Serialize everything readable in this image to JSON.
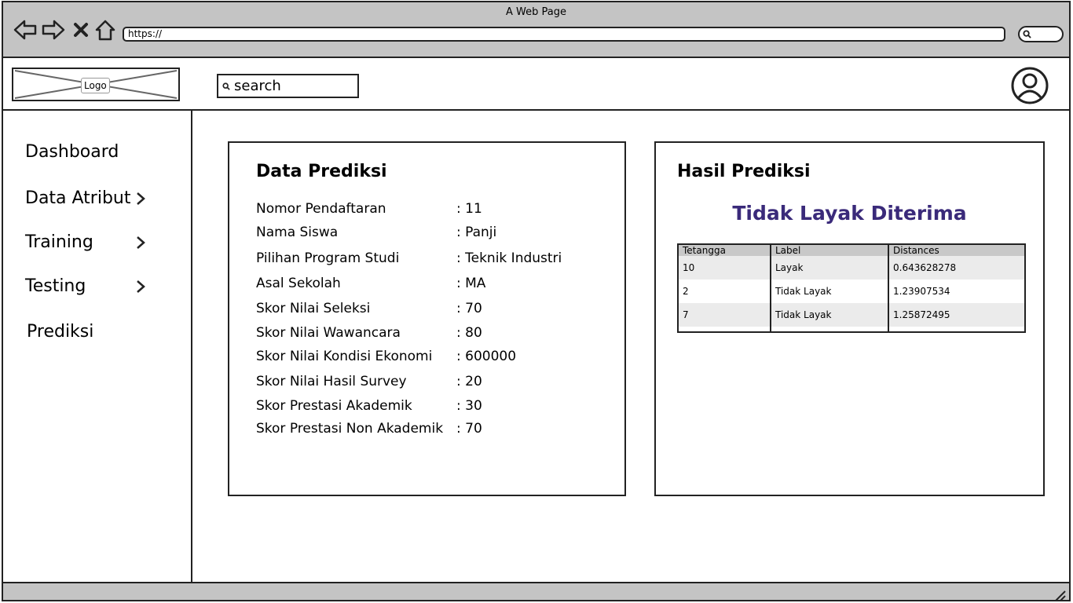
{
  "browser": {
    "window_title": "A Web Page",
    "url": "https://"
  },
  "header": {
    "logo_label": "Logo",
    "search_placeholder": "search"
  },
  "sidebar": {
    "items": [
      {
        "label": "Dashboard",
        "has_submenu": false
      },
      {
        "label": "Data Atribut",
        "has_submenu": true
      },
      {
        "label": "Training",
        "has_submenu": true
      },
      {
        "label": "Testing",
        "has_submenu": true
      },
      {
        "label": "Prediksi",
        "has_submenu": false
      }
    ]
  },
  "data_prediksi": {
    "title": "Data Prediksi",
    "fields": [
      {
        "label": "Nomor Pendaftaran",
        "value": ": 11"
      },
      {
        "label": "Nama Siswa",
        "value": ": Panji"
      },
      {
        "label": "Pilihan Program Studi",
        "value": ": Teknik Industri"
      },
      {
        "label": "Asal Sekolah",
        "value": ": MA"
      },
      {
        "label": "Skor Nilai Seleksi",
        "value": ": 70"
      },
      {
        "label": "Skor Nilai Wawancara",
        "value": ": 80"
      },
      {
        "label": "Skor Nilai Kondisi Ekonomi",
        "value": ": 600000"
      },
      {
        "label": "Skor Nilai Hasil Survey",
        "value": ": 20"
      },
      {
        "label": "Skor Prestasi Akademik",
        "value": ": 30"
      },
      {
        "label": "Skor Prestasi Non Akademik",
        "value": ": 70"
      }
    ]
  },
  "hasil_prediksi": {
    "title": "Hasil Prediksi",
    "result": "Tidak Layak Diterima",
    "result_color": "#3a2a7a",
    "table": {
      "headers": [
        "Tetangga",
        "Label",
        "Distances"
      ],
      "rows": [
        [
          "10",
          "Layak",
          "0.643628278"
        ],
        [
          "2",
          "Tidak Layak",
          "1.23907534"
        ],
        [
          "7",
          "Tidak Layak",
          "1.25872495"
        ]
      ]
    }
  }
}
